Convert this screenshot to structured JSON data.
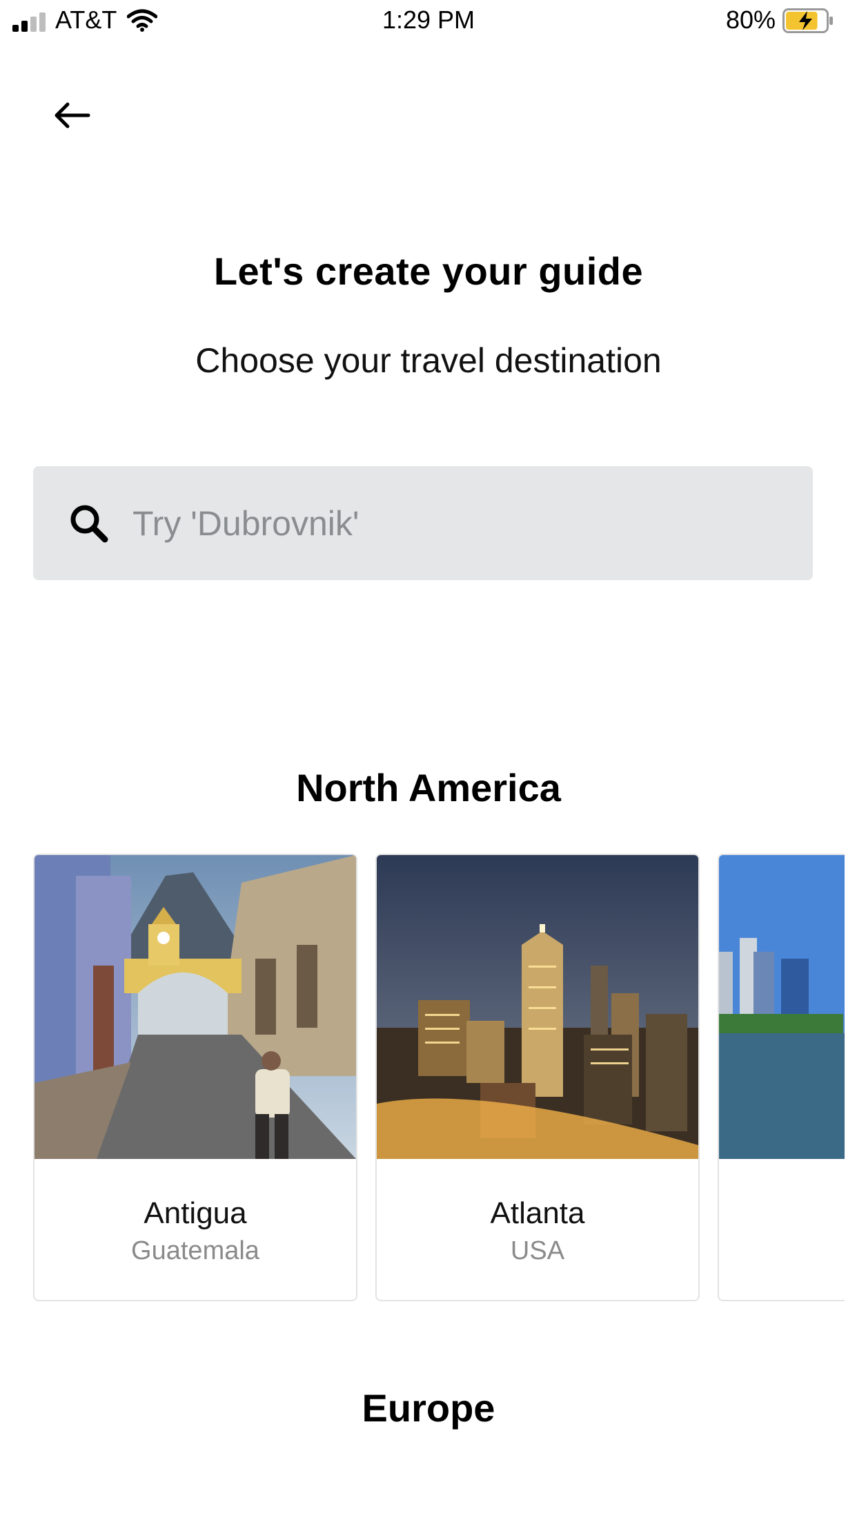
{
  "status_bar": {
    "carrier": "AT&T",
    "time": "1:29 PM",
    "battery_percent": "80%",
    "battery_level": 0.8,
    "battery_color": "#f4c430",
    "icons": [
      "signal-icon",
      "wifi-icon",
      "battery-charging-icon"
    ]
  },
  "header": {
    "back_icon": "arrow-left-icon"
  },
  "intro": {
    "title": "Let's create your guide",
    "subtitle": "Choose your travel destination"
  },
  "search": {
    "icon": "search-icon",
    "placeholder": "Try 'Dubrovnik'",
    "value": ""
  },
  "sections": [
    {
      "title": "North America",
      "destinations": [
        {
          "city": "Antigua",
          "country": "Guatemala",
          "image": "antigua-arch-street-photo"
        },
        {
          "city": "Atlanta",
          "country": "USA",
          "image": "atlanta-skyline-night-photo"
        },
        {
          "city": "",
          "country": "",
          "image": "river-city-skyline-photo"
        }
      ]
    },
    {
      "title": "Europe",
      "destinations": []
    }
  ]
}
